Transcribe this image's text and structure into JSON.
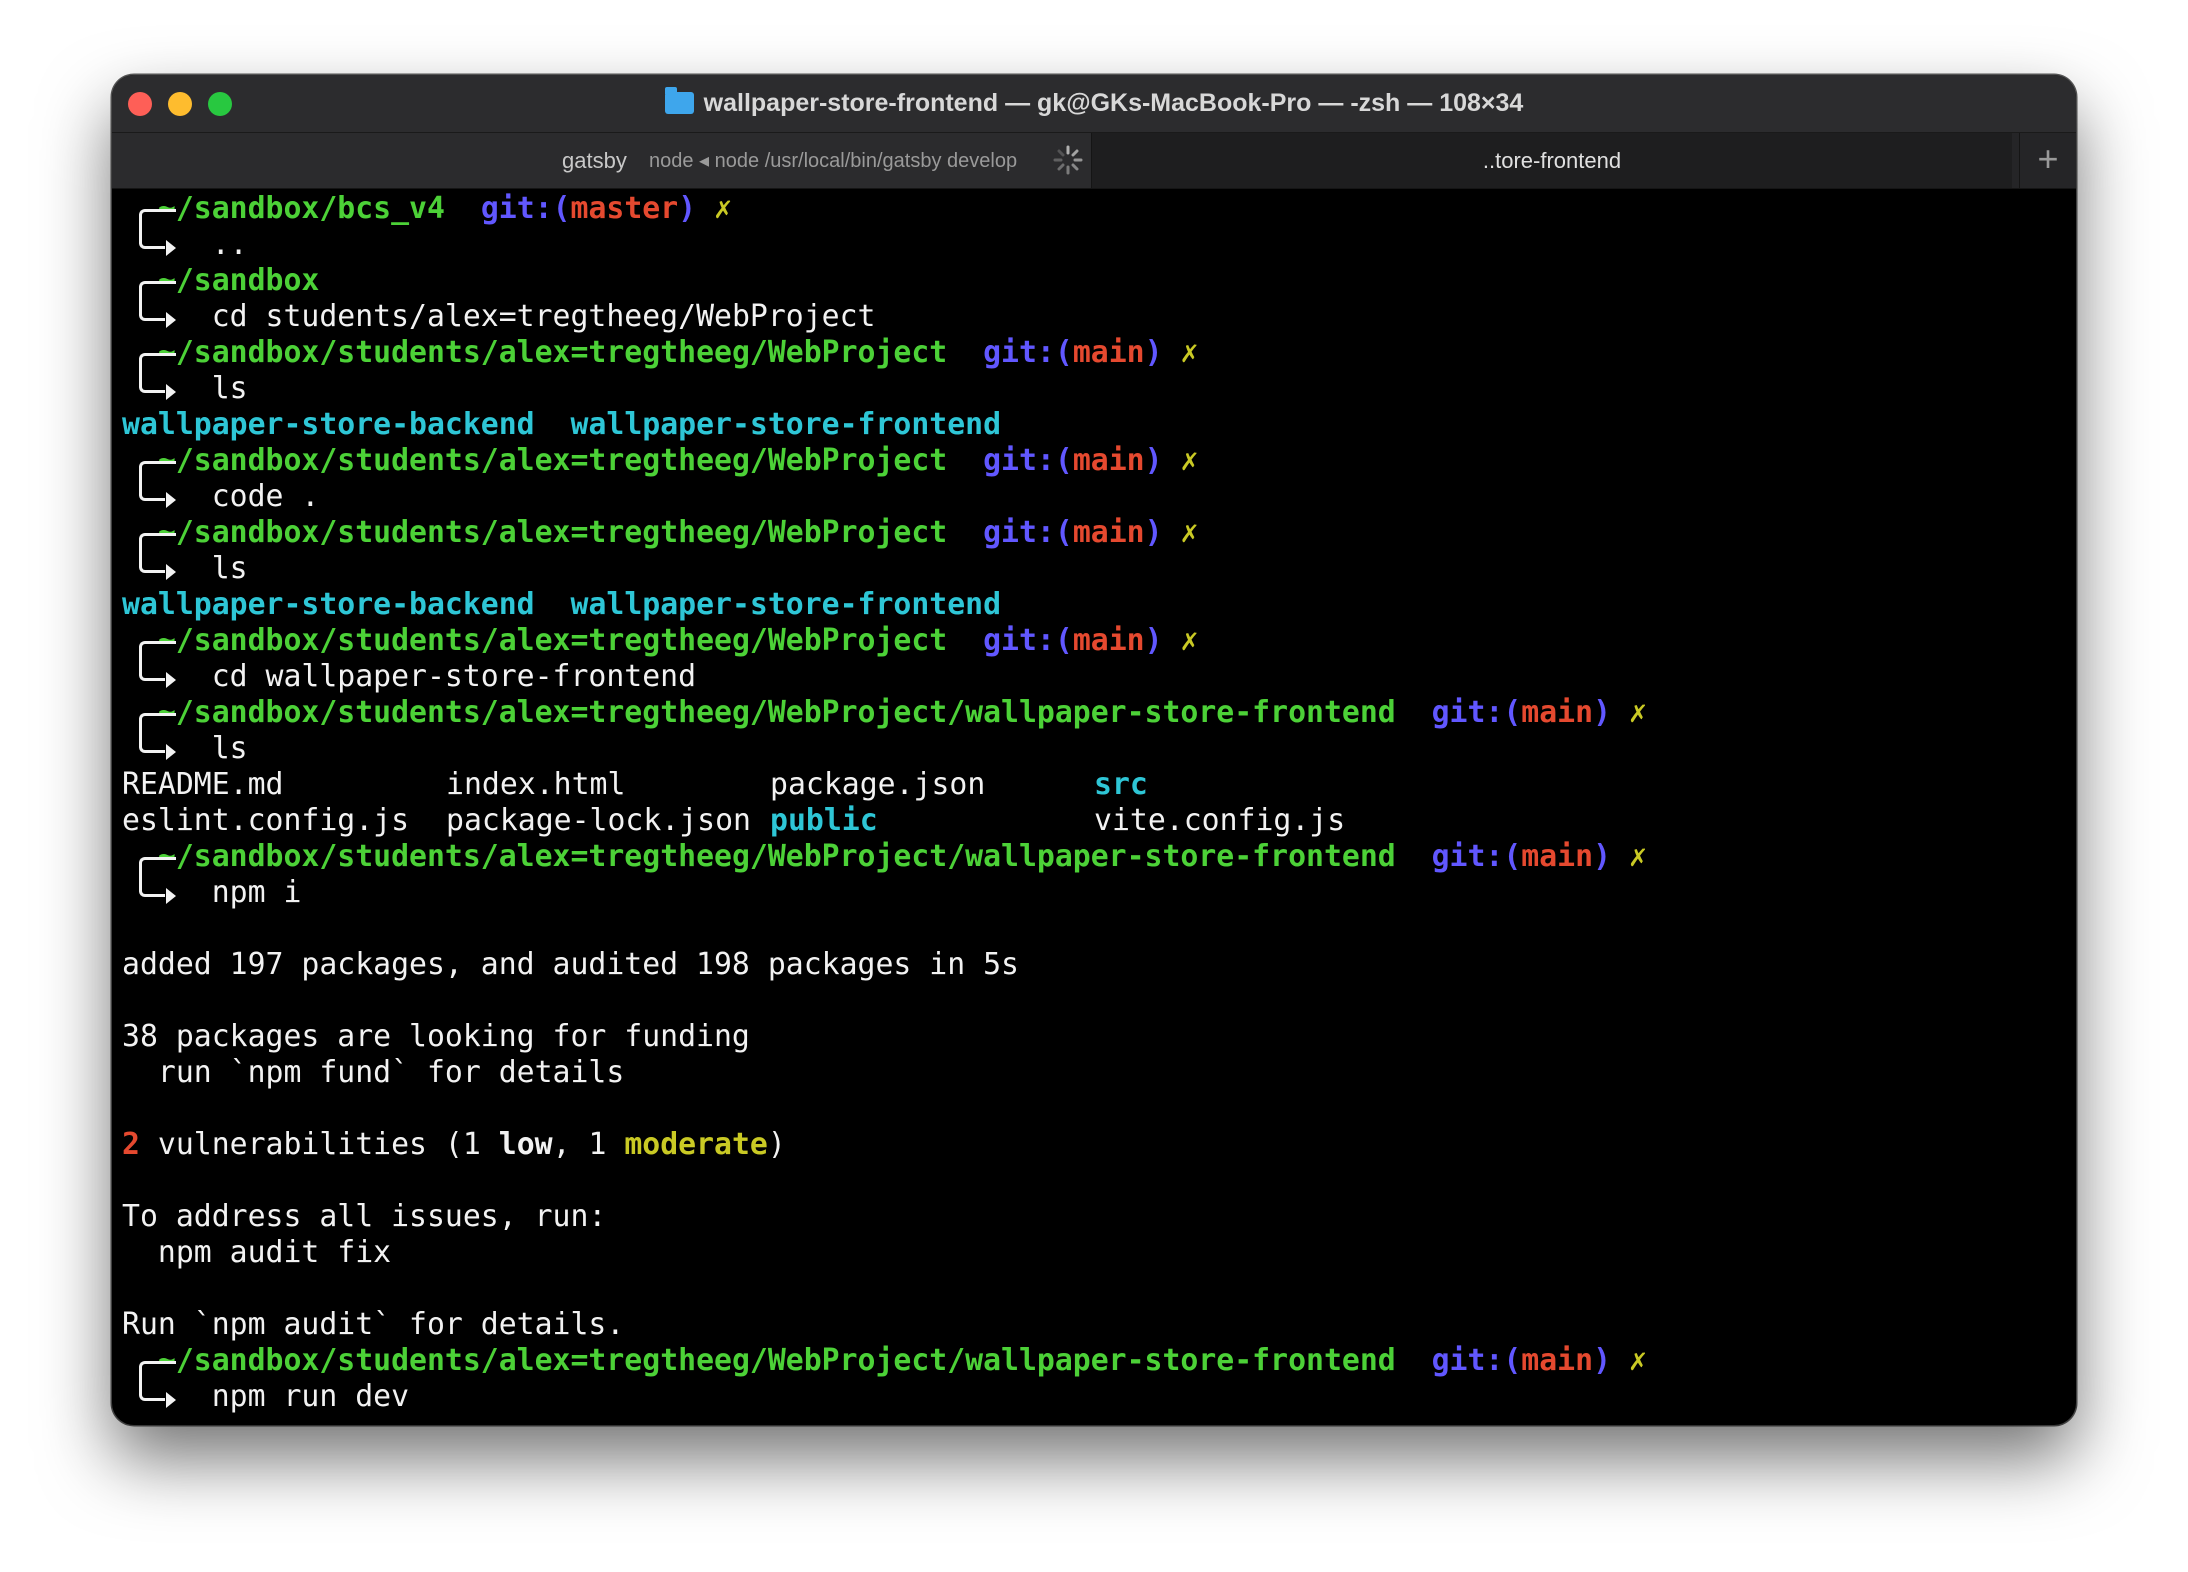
{
  "window": {
    "title": "wallpaper-store-frontend — gk@GKs-MacBook-Pro — -zsh — 108×34"
  },
  "tabs": [
    {
      "label": "gatsby",
      "subtitle": "node ◂ node /usr/local/bin/gatsby develop"
    },
    {
      "label": "..tore-frontend"
    }
  ],
  "new_tab": "+",
  "terminal": {
    "git_prefix": "git:(",
    "git_suffix": ")",
    "dirty_mark": "✗",
    "blocks": [
      {
        "path": "~/sandbox/bcs_v4",
        "branch": "master",
        "command": ".."
      },
      {
        "path": "~/sandbox",
        "command": "cd students/alex=tregtheeg/WebProject"
      },
      {
        "path": "~/sandbox/students/alex=tregtheeg/WebProject",
        "branch": "main",
        "command": "ls"
      },
      {
        "path": "~/sandbox/students/alex=tregtheeg/WebProject",
        "branch": "main",
        "command": "code ."
      },
      {
        "path": "~/sandbox/students/alex=tregtheeg/WebProject",
        "branch": "main",
        "command": "ls"
      },
      {
        "path": "~/sandbox/students/alex=tregtheeg/WebProject",
        "branch": "main",
        "command": "cd wallpaper-store-frontend"
      },
      {
        "path": "~/sandbox/students/alex=tregtheeg/WebProject/wallpaper-store-frontend",
        "branch": "main",
        "command": "ls"
      },
      {
        "path": "~/sandbox/students/alex=tregtheeg/WebProject/wallpaper-store-frontend",
        "branch": "main",
        "command": "npm i"
      },
      {
        "path": "~/sandbox/students/alex=tregtheeg/WebProject/wallpaper-store-frontend",
        "branch": "main",
        "command": "npm run dev"
      }
    ],
    "ls_output": [
      "wallpaper-store-backend",
      "wallpaper-store-frontend"
    ],
    "ls_frontend": {
      "row1": [
        "README.md",
        "index.html",
        "package.json",
        "src"
      ],
      "row2": [
        "eslint.config.js",
        "package-lock.json",
        "public",
        "vite.config.js"
      ]
    },
    "npm_output": {
      "added": "added 197 packages, and audited 198 packages in 5s",
      "funding": "38 packages are looking for funding",
      "fund_hint": "  run `npm fund` for details",
      "vuln_count": "2",
      "vuln_text": " vulnerabilities (1 ",
      "vuln_low": "low",
      "vuln_mid": ", 1 ",
      "vuln_moderate": "moderate",
      "vuln_end": ")",
      "address": "To address all issues, run:",
      "audit_fix": "  npm audit fix",
      "audit_details": "Run `npm audit` for details."
    }
  }
}
